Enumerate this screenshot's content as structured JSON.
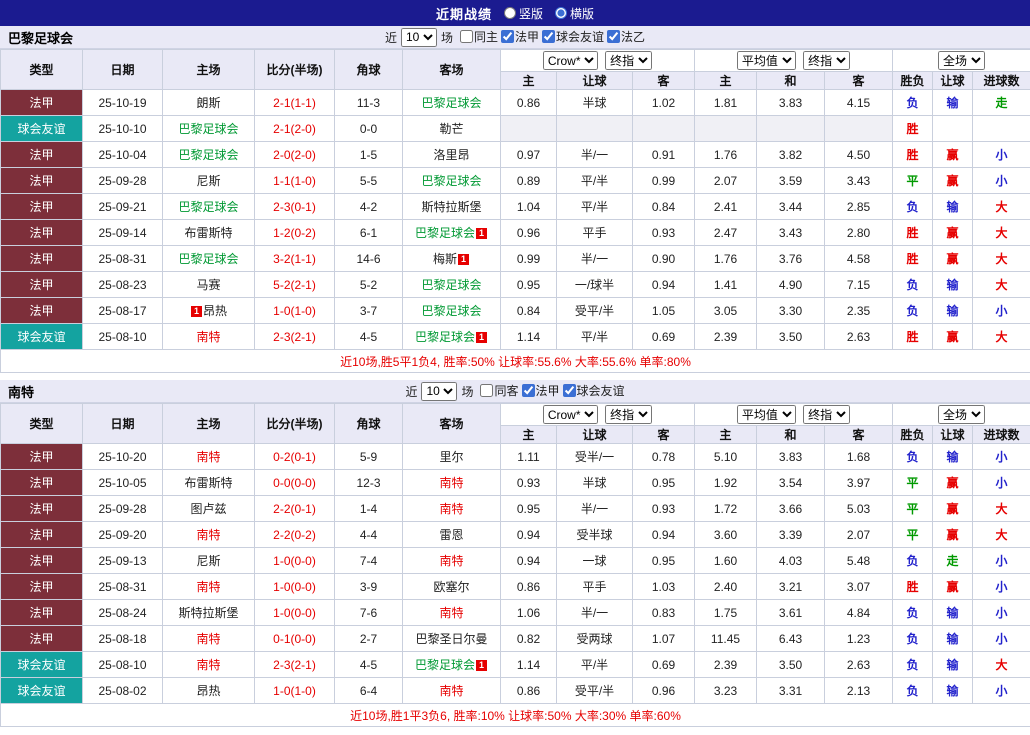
{
  "colors": {
    "topbar_bg": "#1b1b90",
    "section_bg": "#e9e9f6",
    "league1_bg": "#7d2f3a",
    "friendly_bg": "#14a3a0",
    "score_red": "#e60000",
    "paris_green": "#009933",
    "nantes_red": "#e60000",
    "win": "#e60000",
    "draw": "#009900",
    "lose": "#2222cc"
  },
  "top_bar": {
    "title": "近期战绩",
    "radios": [
      {
        "label": "竖版",
        "checked": false
      },
      {
        "label": "横版",
        "checked": true
      }
    ]
  },
  "table_headers": [
    "类型",
    "日期",
    "主场",
    "比分(半场)",
    "角球",
    "客场"
  ],
  "odds_header": {
    "bookmaker_select": "Crow*",
    "stage_select": "终指",
    "avg_select": "平均值",
    "avg_stage_select": "终指",
    "scope_select": "全场",
    "sub_cols": [
      "主",
      "让球",
      "客",
      "主",
      "和",
      "客",
      "胜负",
      "让球",
      "进球数"
    ]
  },
  "sections": [
    {
      "team": "巴黎足球会",
      "filter": {
        "near_label": "近",
        "matches_select": "10",
        "games_label": "场",
        "checkboxes": [
          {
            "label": "同主",
            "checked": false
          },
          {
            "label": "法甲",
            "checked": true
          },
          {
            "label": "球会友谊",
            "checked": true
          },
          {
            "label": "法乙",
            "checked": true
          }
        ]
      },
      "rows": [
        {
          "league": "法甲",
          "lt": "l1",
          "date": "25-10-19",
          "home": {
            "name": "朗斯",
            "color": "plain"
          },
          "score": "2-1(1-1)",
          "corners": "11-3",
          "away": {
            "name": "巴黎足球会",
            "color": "paris"
          },
          "odds": [
            "0.86",
            "半球",
            "1.02"
          ],
          "avg": [
            "1.81",
            "3.83",
            "4.15"
          ],
          "results": [
            {
              "text": "负",
              "tone": "lose"
            },
            {
              "text": "输",
              "tone": "lose"
            },
            {
              "text": "走",
              "tone": "draw"
            }
          ]
        },
        {
          "league": "球会友谊",
          "lt": "fr",
          "date": "25-10-10",
          "home": {
            "name": "巴黎足球会",
            "color": "paris"
          },
          "score": "2-1(2-0)",
          "corners": "0-0",
          "away": {
            "name": "勒芒",
            "color": "plain"
          },
          "odds": [
            "",
            "",
            ""
          ],
          "avg": [
            "",
            "",
            ""
          ],
          "odds_empty": true,
          "results": [
            {
              "text": "胜",
              "tone": "win"
            },
            {
              "text": "",
              "tone": "none"
            },
            {
              "text": "",
              "tone": "none"
            }
          ]
        },
        {
          "league": "法甲",
          "lt": "l1",
          "date": "25-10-04",
          "home": {
            "name": "巴黎足球会",
            "color": "paris"
          },
          "score": "2-0(2-0)",
          "corners": "1-5",
          "away": {
            "name": "洛里昂",
            "color": "plain"
          },
          "odds": [
            "0.97",
            "半/一",
            "0.91"
          ],
          "avg": [
            "1.76",
            "3.82",
            "4.50"
          ],
          "results": [
            {
              "text": "胜",
              "tone": "win"
            },
            {
              "text": "赢",
              "tone": "win"
            },
            {
              "text": "小",
              "tone": "lose"
            }
          ]
        },
        {
          "league": "法甲",
          "lt": "l1",
          "date": "25-09-28",
          "home": {
            "name": "尼斯",
            "color": "plain"
          },
          "score": "1-1(1-0)",
          "corners": "5-5",
          "away": {
            "name": "巴黎足球会",
            "color": "paris"
          },
          "odds": [
            "0.89",
            "平/半",
            "0.99"
          ],
          "avg": [
            "2.07",
            "3.59",
            "3.43"
          ],
          "results": [
            {
              "text": "平",
              "tone": "draw"
            },
            {
              "text": "赢",
              "tone": "win"
            },
            {
              "text": "小",
              "tone": "lose"
            }
          ]
        },
        {
          "league": "法甲",
          "lt": "l1",
          "date": "25-09-21",
          "home": {
            "name": "巴黎足球会",
            "color": "paris"
          },
          "score": "2-3(0-1)",
          "corners": "4-2",
          "away": {
            "name": "斯特拉斯堡",
            "color": "plain"
          },
          "odds": [
            "1.04",
            "平/半",
            "0.84"
          ],
          "avg": [
            "2.41",
            "3.44",
            "2.85"
          ],
          "results": [
            {
              "text": "负",
              "tone": "lose"
            },
            {
              "text": "输",
              "tone": "lose"
            },
            {
              "text": "大",
              "tone": "win"
            }
          ]
        },
        {
          "league": "法甲",
          "lt": "l1",
          "date": "25-09-14",
          "home": {
            "name": "布雷斯特",
            "color": "plain"
          },
          "score": "1-2(0-2)",
          "corners": "6-1",
          "away": {
            "name": "巴黎足球会",
            "color": "paris",
            "badge": "1",
            "badge_pos": "after"
          },
          "odds": [
            "0.96",
            "平手",
            "0.93"
          ],
          "avg": [
            "2.47",
            "3.43",
            "2.80"
          ],
          "results": [
            {
              "text": "胜",
              "tone": "win"
            },
            {
              "text": "赢",
              "tone": "win"
            },
            {
              "text": "大",
              "tone": "win"
            }
          ]
        },
        {
          "league": "法甲",
          "lt": "l1",
          "date": "25-08-31",
          "home": {
            "name": "巴黎足球会",
            "color": "paris"
          },
          "score": "3-2(1-1)",
          "corners": "14-6",
          "away": {
            "name": "梅斯",
            "color": "plain",
            "badge": "1",
            "badge_pos": "after"
          },
          "odds": [
            "0.99",
            "半/一",
            "0.90"
          ],
          "avg": [
            "1.76",
            "3.76",
            "4.58"
          ],
          "results": [
            {
              "text": "胜",
              "tone": "win"
            },
            {
              "text": "赢",
              "tone": "win"
            },
            {
              "text": "大",
              "tone": "win"
            }
          ]
        },
        {
          "league": "法甲",
          "lt": "l1",
          "date": "25-08-23",
          "home": {
            "name": "马赛",
            "color": "plain"
          },
          "score": "5-2(2-1)",
          "corners": "5-2",
          "away": {
            "name": "巴黎足球会",
            "color": "paris"
          },
          "odds": [
            "0.95",
            "一/球半",
            "0.94"
          ],
          "avg": [
            "1.41",
            "4.90",
            "7.15"
          ],
          "results": [
            {
              "text": "负",
              "tone": "lose"
            },
            {
              "text": "输",
              "tone": "lose"
            },
            {
              "text": "大",
              "tone": "win"
            }
          ]
        },
        {
          "league": "法甲",
          "lt": "l1",
          "date": "25-08-17",
          "home": {
            "name": "昂热",
            "color": "plain",
            "badge": "1",
            "badge_pos": "before"
          },
          "score": "1-0(1-0)",
          "corners": "3-7",
          "away": {
            "name": "巴黎足球会",
            "color": "paris"
          },
          "odds": [
            "0.84",
            "受平/半",
            "1.05"
          ],
          "avg": [
            "3.05",
            "3.30",
            "2.35"
          ],
          "results": [
            {
              "text": "负",
              "tone": "lose"
            },
            {
              "text": "输",
              "tone": "lose"
            },
            {
              "text": "小",
              "tone": "lose"
            }
          ]
        },
        {
          "league": "球会友谊",
          "lt": "fr",
          "date": "25-08-10",
          "home": {
            "name": "南特",
            "color": "nantes"
          },
          "score": "2-3(2-1)",
          "corners": "4-5",
          "away": {
            "name": "巴黎足球会",
            "color": "paris",
            "badge": "1",
            "badge_pos": "after"
          },
          "odds": [
            "1.14",
            "平/半",
            "0.69"
          ],
          "avg": [
            "2.39",
            "3.50",
            "2.63"
          ],
          "results": [
            {
              "text": "胜",
              "tone": "win"
            },
            {
              "text": "赢",
              "tone": "win"
            },
            {
              "text": "大",
              "tone": "win"
            }
          ]
        }
      ],
      "summary": "近10场,胜5平1负4, 胜率:50% 让球率:55.6% 大率:55.6% 单率:80%"
    },
    {
      "team": "南特",
      "filter": {
        "near_label": "近",
        "matches_select": "10",
        "games_label": "场",
        "checkboxes": [
          {
            "label": "同客",
            "checked": false
          },
          {
            "label": "法甲",
            "checked": true
          },
          {
            "label": "球会友谊",
            "checked": true
          }
        ]
      },
      "rows": [
        {
          "league": "法甲",
          "lt": "l1",
          "date": "25-10-20",
          "home": {
            "name": "南特",
            "color": "nantes"
          },
          "score": "0-2(0-1)",
          "corners": "5-9",
          "away": {
            "name": "里尔",
            "color": "plain"
          },
          "odds": [
            "1.11",
            "受半/一",
            "0.78"
          ],
          "avg": [
            "5.10",
            "3.83",
            "1.68"
          ],
          "results": [
            {
              "text": "负",
              "tone": "lose"
            },
            {
              "text": "输",
              "tone": "lose"
            },
            {
              "text": "小",
              "tone": "lose"
            }
          ]
        },
        {
          "league": "法甲",
          "lt": "l1",
          "date": "25-10-05",
          "home": {
            "name": "布雷斯特",
            "color": "plain"
          },
          "score": "0-0(0-0)",
          "corners": "12-3",
          "away": {
            "name": "南特",
            "color": "nantes"
          },
          "odds": [
            "0.93",
            "半球",
            "0.95"
          ],
          "avg": [
            "1.92",
            "3.54",
            "3.97"
          ],
          "results": [
            {
              "text": "平",
              "tone": "draw"
            },
            {
              "text": "赢",
              "tone": "win"
            },
            {
              "text": "小",
              "tone": "lose"
            }
          ]
        },
        {
          "league": "法甲",
          "lt": "l1",
          "date": "25-09-28",
          "home": {
            "name": "图卢兹",
            "color": "plain"
          },
          "score": "2-2(0-1)",
          "corners": "1-4",
          "away": {
            "name": "南特",
            "color": "nantes"
          },
          "odds": [
            "0.95",
            "半/一",
            "0.93"
          ],
          "avg": [
            "1.72",
            "3.66",
            "5.03"
          ],
          "results": [
            {
              "text": "平",
              "tone": "draw"
            },
            {
              "text": "赢",
              "tone": "win"
            },
            {
              "text": "大",
              "tone": "win"
            }
          ]
        },
        {
          "league": "法甲",
          "lt": "l1",
          "date": "25-09-20",
          "home": {
            "name": "南特",
            "color": "nantes"
          },
          "score": "2-2(0-2)",
          "corners": "4-4",
          "away": {
            "name": "雷恩",
            "color": "plain"
          },
          "odds": [
            "0.94",
            "受半球",
            "0.94"
          ],
          "avg": [
            "3.60",
            "3.39",
            "2.07"
          ],
          "results": [
            {
              "text": "平",
              "tone": "draw"
            },
            {
              "text": "赢",
              "tone": "win"
            },
            {
              "text": "大",
              "tone": "win"
            }
          ]
        },
        {
          "league": "法甲",
          "lt": "l1",
          "date": "25-09-13",
          "home": {
            "name": "尼斯",
            "color": "plain"
          },
          "score": "1-0(0-0)",
          "corners": "7-4",
          "away": {
            "name": "南特",
            "color": "nantes"
          },
          "odds": [
            "0.94",
            "一球",
            "0.95"
          ],
          "avg": [
            "1.60",
            "4.03",
            "5.48"
          ],
          "results": [
            {
              "text": "负",
              "tone": "lose"
            },
            {
              "text": "走",
              "tone": "draw"
            },
            {
              "text": "小",
              "tone": "lose"
            }
          ]
        },
        {
          "league": "法甲",
          "lt": "l1",
          "date": "25-08-31",
          "home": {
            "name": "南特",
            "color": "nantes"
          },
          "score": "1-0(0-0)",
          "corners": "3-9",
          "away": {
            "name": "欧塞尔",
            "color": "plain"
          },
          "odds": [
            "0.86",
            "平手",
            "1.03"
          ],
          "avg": [
            "2.40",
            "3.21",
            "3.07"
          ],
          "results": [
            {
              "text": "胜",
              "tone": "win"
            },
            {
              "text": "赢",
              "tone": "win"
            },
            {
              "text": "小",
              "tone": "lose"
            }
          ]
        },
        {
          "league": "法甲",
          "lt": "l1",
          "date": "25-08-24",
          "home": {
            "name": "斯特拉斯堡",
            "color": "plain"
          },
          "score": "1-0(0-0)",
          "corners": "7-6",
          "away": {
            "name": "南特",
            "color": "nantes"
          },
          "odds": [
            "1.06",
            "半/一",
            "0.83"
          ],
          "avg": [
            "1.75",
            "3.61",
            "4.84"
          ],
          "results": [
            {
              "text": "负",
              "tone": "lose"
            },
            {
              "text": "输",
              "tone": "lose"
            },
            {
              "text": "小",
              "tone": "lose"
            }
          ]
        },
        {
          "league": "法甲",
          "lt": "l1",
          "date": "25-08-18",
          "home": {
            "name": "南特",
            "color": "nantes"
          },
          "score": "0-1(0-0)",
          "corners": "2-7",
          "away": {
            "name": "巴黎圣日尔曼",
            "color": "plain"
          },
          "odds": [
            "0.82",
            "受两球",
            "1.07"
          ],
          "avg": [
            "11.45",
            "6.43",
            "1.23"
          ],
          "results": [
            {
              "text": "负",
              "tone": "lose"
            },
            {
              "text": "输",
              "tone": "lose"
            },
            {
              "text": "小",
              "tone": "lose"
            }
          ]
        },
        {
          "league": "球会友谊",
          "lt": "fr",
          "date": "25-08-10",
          "home": {
            "name": "南特",
            "color": "nantes"
          },
          "score": "2-3(2-1)",
          "corners": "4-5",
          "away": {
            "name": "巴黎足球会",
            "color": "paris",
            "badge": "1",
            "badge_pos": "after"
          },
          "odds": [
            "1.14",
            "平/半",
            "0.69"
          ],
          "avg": [
            "2.39",
            "3.50",
            "2.63"
          ],
          "results": [
            {
              "text": "负",
              "tone": "lose"
            },
            {
              "text": "输",
              "tone": "lose"
            },
            {
              "text": "大",
              "tone": "win"
            }
          ]
        },
        {
          "league": "球会友谊",
          "lt": "fr",
          "date": "25-08-02",
          "home": {
            "name": "昂热",
            "color": "plain"
          },
          "score": "1-0(1-0)",
          "corners": "6-4",
          "away": {
            "name": "南特",
            "color": "nantes"
          },
          "odds": [
            "0.86",
            "受平/半",
            "0.96"
          ],
          "avg": [
            "3.23",
            "3.31",
            "2.13"
          ],
          "results": [
            {
              "text": "负",
              "tone": "lose"
            },
            {
              "text": "输",
              "tone": "lose"
            },
            {
              "text": "小",
              "tone": "lose"
            }
          ]
        }
      ],
      "summary": "近10场,胜1平3负6, 胜率:10% 让球率:50% 大率:30% 单率:60%"
    }
  ]
}
